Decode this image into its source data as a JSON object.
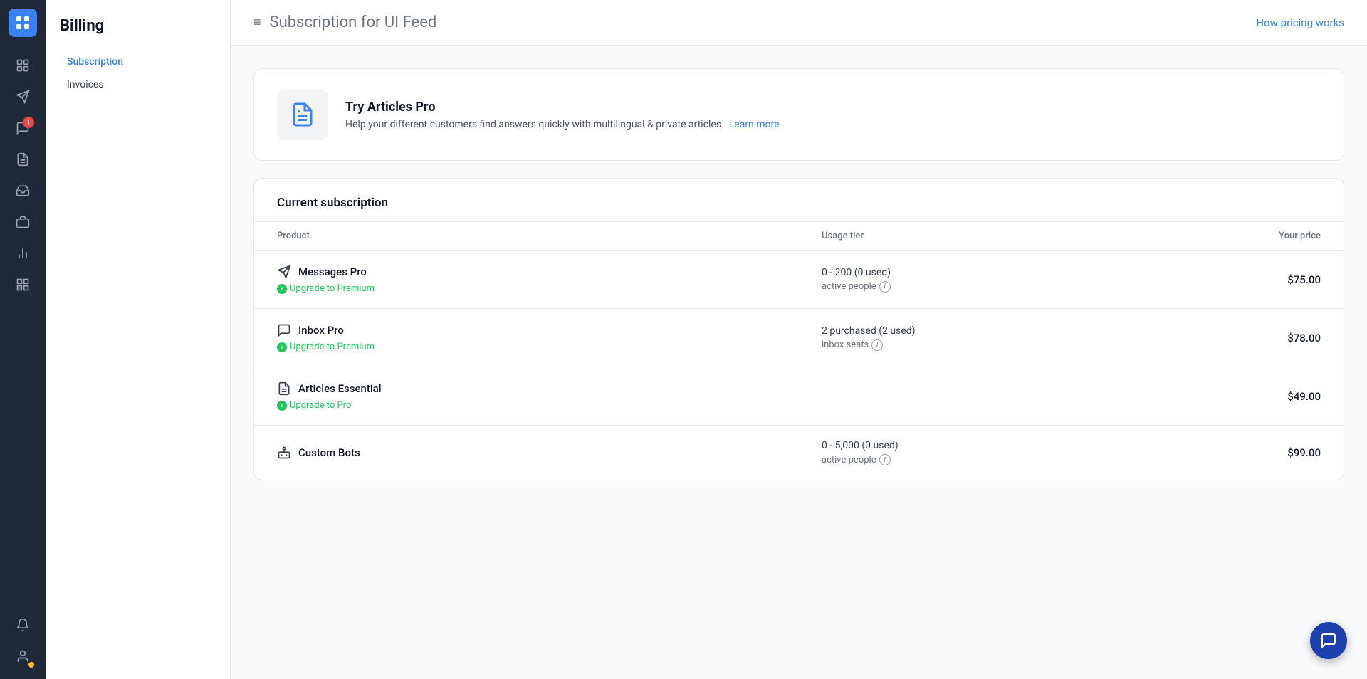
{
  "page": {
    "title": "Billing",
    "subtitle": "Subscription",
    "page_heading": "Subscription",
    "page_heading_suffix": " for UI Feed",
    "how_pricing_link": "How pricing works"
  },
  "nav": {
    "items": [
      {
        "label": "Subscription",
        "active": true
      },
      {
        "label": "Invoices",
        "active": false
      }
    ]
  },
  "banner": {
    "title": "Try Articles Pro",
    "description": "Help your different customers find answers quickly with multilingual & private articles.",
    "link_text": "Learn more"
  },
  "subscription": {
    "section_title": "Current subscription",
    "table_headers": {
      "product": "Product",
      "usage_tier": "Usage tier",
      "your_price": "Your price"
    },
    "rows": [
      {
        "product_name": "Messages Pro",
        "upgrade_label": "Upgrade to Premium",
        "usage_tier": "0 - 200 (0 used)",
        "usage_unit": "active people",
        "price": "$75.00",
        "has_info": true
      },
      {
        "product_name": "Inbox Pro",
        "upgrade_label": "Upgrade to Premium",
        "usage_tier": "2 purchased (2 used)",
        "usage_unit": "inbox seats",
        "price": "$78.00",
        "has_info": true
      },
      {
        "product_name": "Articles Essential",
        "upgrade_label": "Upgrade to Pro",
        "usage_tier": "",
        "usage_unit": "",
        "price": "$49.00",
        "has_info": false
      },
      {
        "product_name": "Custom Bots",
        "upgrade_label": "",
        "usage_tier": "0 - 5,000 (0 used)",
        "usage_unit": "active people",
        "price": "$99.00",
        "has_info": true
      }
    ]
  },
  "icons": {
    "logo": "⊞",
    "menu": "≡",
    "sidebar": [
      {
        "name": "contacts-icon",
        "symbol": "👤"
      },
      {
        "name": "messages-icon",
        "symbol": "✈"
      },
      {
        "name": "inbox-icon",
        "symbol": "💬",
        "badge": "1"
      },
      {
        "name": "reports-icon",
        "symbol": "📋"
      },
      {
        "name": "inbox2-icon",
        "symbol": "📥"
      },
      {
        "name": "orders-icon",
        "symbol": "🗂"
      },
      {
        "name": "analytics-icon",
        "symbol": "📊"
      },
      {
        "name": "apps-icon",
        "symbol": "⊞"
      },
      {
        "name": "notifications-icon",
        "symbol": "🔔"
      },
      {
        "name": "profile-icon",
        "symbol": "👤",
        "has_dot": true
      }
    ]
  }
}
